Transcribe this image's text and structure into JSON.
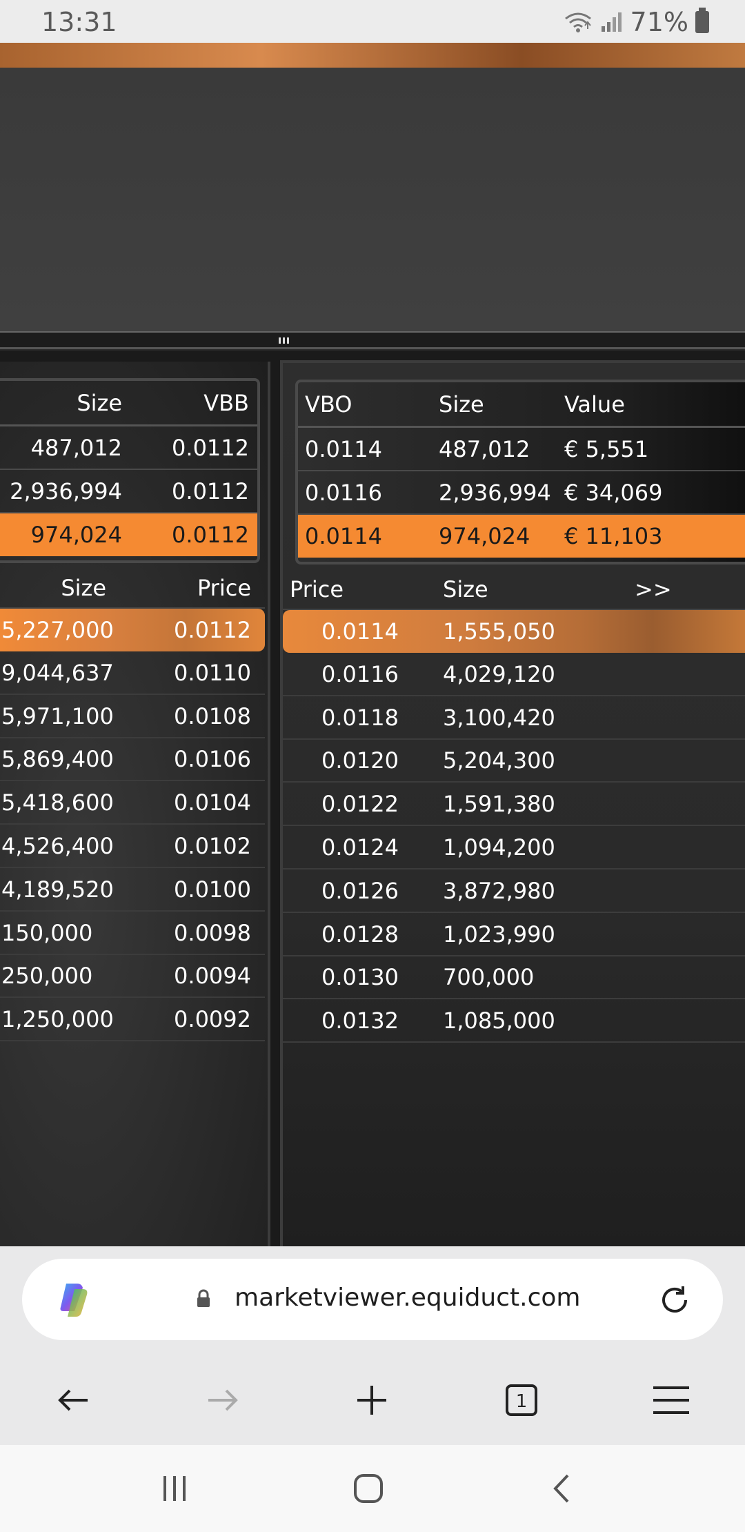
{
  "status_bar": {
    "time": "13:31",
    "battery_percent": "71%",
    "icons": [
      "wifi-icon",
      "signal-icon",
      "battery-icon"
    ]
  },
  "vbb_table": {
    "headers": {
      "size": "Size",
      "vbb": "VBB"
    },
    "rows": [
      {
        "size": "487,012",
        "vbb": "0.0112"
      },
      {
        "size": "2,936,994",
        "vbb": "0.0112"
      },
      {
        "size": "974,024",
        "vbb": "0.0112"
      }
    ]
  },
  "vbo_table": {
    "headers": {
      "vbo": "VBO",
      "size": "Size",
      "value": "Value"
    },
    "rows": [
      {
        "vbo": "0.0114",
        "size": "487,012",
        "value": "€ 5,551"
      },
      {
        "vbo": "0.0116",
        "size": "2,936,994",
        "value": "€ 34,069"
      },
      {
        "vbo": "0.0114",
        "size": "974,024",
        "value": "€ 11,103"
      }
    ]
  },
  "bid_book": {
    "headers": {
      "size": "Size",
      "price": "Price"
    },
    "rows": [
      {
        "size": "5,227,000",
        "price": "0.0112"
      },
      {
        "size": "9,044,637",
        "price": "0.0110"
      },
      {
        "size": "5,971,100",
        "price": "0.0108"
      },
      {
        "size": "5,869,400",
        "price": "0.0106"
      },
      {
        "size": "5,418,600",
        "price": "0.0104"
      },
      {
        "size": "4,526,400",
        "price": "0.0102"
      },
      {
        "size": "4,189,520",
        "price": "0.0100"
      },
      {
        "size": "150,000",
        "price": "0.0098"
      },
      {
        "size": "250,000",
        "price": "0.0094"
      },
      {
        "size": "1,250,000",
        "price": "0.0092"
      }
    ]
  },
  "ask_book": {
    "headers": {
      "price": "Price",
      "size": "Size",
      "more": ">>"
    },
    "rows": [
      {
        "price": "0.0114",
        "size": "1,555,050"
      },
      {
        "price": "0.0116",
        "size": "4,029,120"
      },
      {
        "price": "0.0118",
        "size": "3,100,420"
      },
      {
        "price": "0.0120",
        "size": "5,204,300"
      },
      {
        "price": "0.0122",
        "size": "1,591,380"
      },
      {
        "price": "0.0124",
        "size": "1,094,200"
      },
      {
        "price": "0.0126",
        "size": "3,872,980"
      },
      {
        "price": "0.0128",
        "size": "1,023,990"
      },
      {
        "price": "0.0130",
        "size": "700,000"
      },
      {
        "price": "0.0132",
        "size": "1,085,000"
      }
    ]
  },
  "browser": {
    "url": "marketviewer.equiduct.com",
    "tab_count": "1"
  },
  "colors": {
    "accent_orange": "#f58a32",
    "panel_bg": "#2a2a2a"
  }
}
